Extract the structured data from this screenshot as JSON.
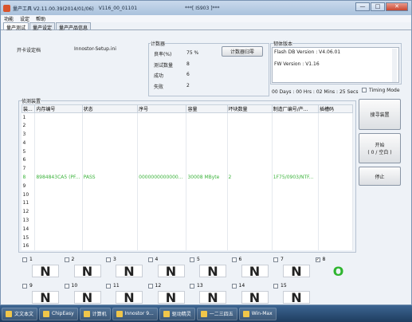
{
  "window": {
    "title": "量产工具 V2.11.00.39(2014/01/06)",
    "build": "V116_00_01101",
    "device_tag": "***[ IS903 ]***",
    "buttons": [
      "—",
      "□",
      "✕"
    ]
  },
  "menu": [
    "功能",
    "设定",
    "帮助"
  ],
  "tabs": [
    "量产测试",
    "量产设定",
    "量产产品信息"
  ],
  "setup": {
    "label": "开卡设定档",
    "value": "Innostor-Setup.ini"
  },
  "counter": {
    "group_title": "计数器",
    "rows": [
      {
        "label": "良率(%)",
        "value": "75 %"
      },
      {
        "label": "测试数量",
        "value": "8"
      },
      {
        "label": "成功",
        "value": "6"
      },
      {
        "label": "失败",
        "value": "2"
      }
    ],
    "reset_button": "计数器归零"
  },
  "firmware": {
    "group_title": "韧体版本",
    "flash_db": "Flash DB Version : V4.06.01",
    "fw": "FW Version :  V1.16"
  },
  "elapsed": "00 Days : 00 Hrs : 02 Mins : 25 Secs",
  "timing_mode": "Timing Mode",
  "device_group_title": "侦测装置",
  "table": {
    "headers": [
      "装...",
      "内存编号",
      "状态",
      "序号",
      "容量",
      "坏块数量",
      "制造厂编号/产...",
      "插槽码"
    ],
    "rows": [
      [
        "1",
        "",
        "",
        "",
        "",
        "",
        "",
        ""
      ],
      [
        "2",
        "",
        "",
        "",
        "",
        "",
        "",
        ""
      ],
      [
        "3",
        "",
        "",
        "",
        "",
        "",
        "",
        ""
      ],
      [
        "4",
        "",
        "",
        "",
        "",
        "",
        "",
        ""
      ],
      [
        "5",
        "",
        "",
        "",
        "",
        "",
        "",
        ""
      ],
      [
        "6",
        "",
        "",
        "",
        "",
        "",
        "",
        ""
      ],
      [
        "7",
        "",
        "",
        "",
        "",
        "",
        "",
        ""
      ],
      [
        "8",
        "8984843CA5 (PF...",
        "PASS",
        "0000000000000...",
        "30008 MByte",
        "2",
        "1F75/0903/NTF...",
        ""
      ],
      [
        "9",
        "",
        "",
        "",
        "",
        "",
        "",
        ""
      ],
      [
        "10",
        "",
        "",
        "",
        "",
        "",
        "",
        ""
      ],
      [
        "11",
        "",
        "",
        "",
        "",
        "",
        "",
        ""
      ],
      [
        "12",
        "",
        "",
        "",
        "",
        "",
        "",
        ""
      ],
      [
        "13",
        "",
        "",
        "",
        "",
        "",
        "",
        ""
      ],
      [
        "14",
        "",
        "",
        "",
        "",
        "",
        "",
        ""
      ],
      [
        "15",
        "",
        "",
        "",
        "",
        "",
        "",
        ""
      ],
      [
        "16",
        "",
        "",
        "",
        "",
        "",
        "",
        ""
      ]
    ]
  },
  "side_buttons": {
    "scan": "搜寻装置",
    "start_line1": "开始",
    "start_line2": "( 0 / 空白 )",
    "stop": "停止"
  },
  "slots_row1": [
    {
      "n": "1",
      "s": "N"
    },
    {
      "n": "2",
      "s": "N"
    },
    {
      "n": "3",
      "s": "N"
    },
    {
      "n": "4",
      "s": "N"
    },
    {
      "n": "5",
      "s": "N"
    },
    {
      "n": "6",
      "s": "N"
    },
    {
      "n": "7",
      "s": "N"
    },
    {
      "n": "8",
      "s": "O",
      "checked": true
    }
  ],
  "slots_row2": [
    {
      "n": "9",
      "s": "N"
    },
    {
      "n": "10",
      "s": "N"
    },
    {
      "n": "11",
      "s": "N"
    },
    {
      "n": "12",
      "s": "N"
    },
    {
      "n": "13",
      "s": "N"
    },
    {
      "n": "14",
      "s": "N"
    },
    {
      "n": "15",
      "s": "N"
    }
  ],
  "taskbar": [
    "文文本文",
    "ChipEasy",
    "计算机",
    "Innostor 9...",
    "驱动精灵",
    "一二三四五",
    "Win-Max"
  ]
}
